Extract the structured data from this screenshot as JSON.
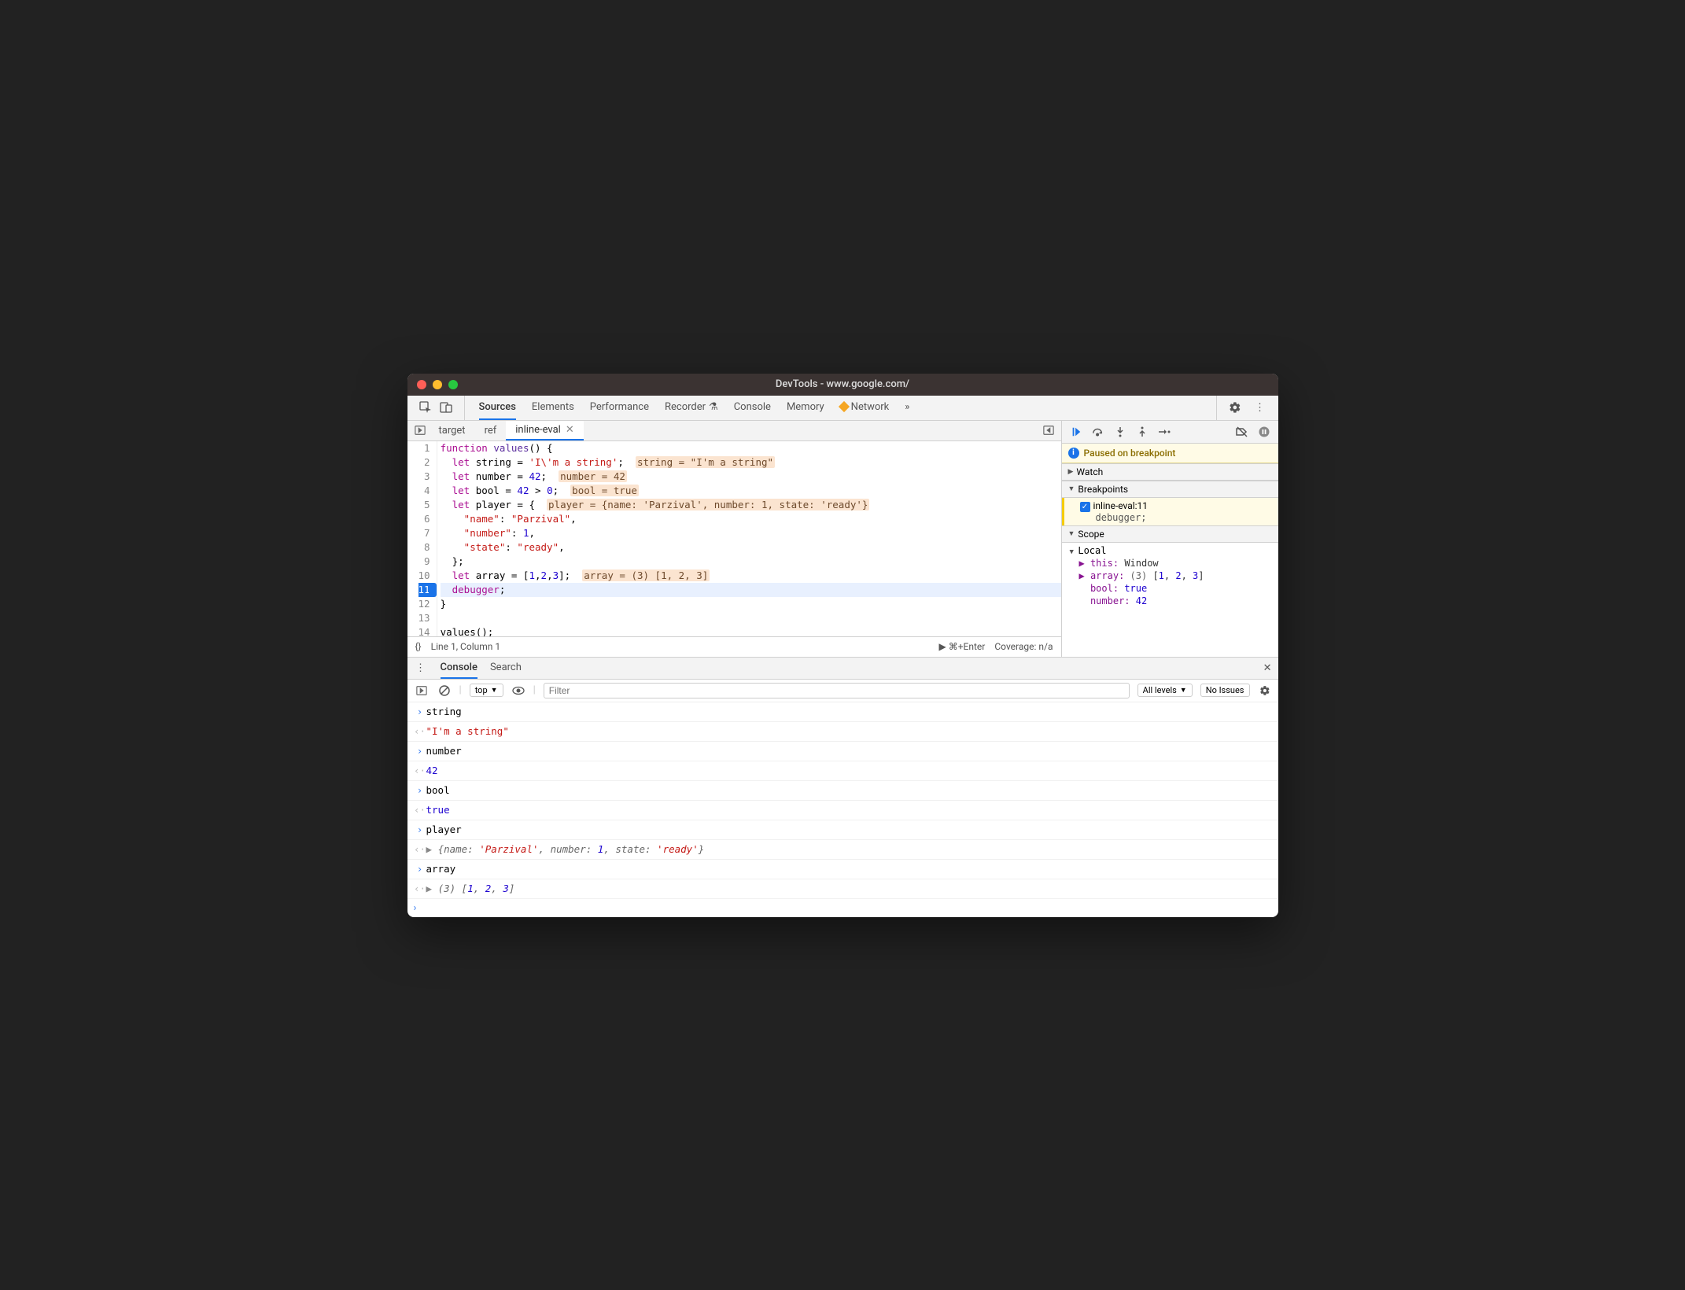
{
  "window": {
    "title": "DevTools - www.google.com/"
  },
  "mainTabs": [
    "Sources",
    "Elements",
    "Performance",
    "Recorder",
    "Console",
    "Memory",
    "Network"
  ],
  "activeMainTab": "Sources",
  "networkWarning": true,
  "fileTabs": {
    "items": [
      "target",
      "ref",
      "inline-eval"
    ],
    "active": "inline-eval"
  },
  "code": {
    "lines": [
      {
        "n": 1,
        "html": "<span class='kw'>function</span> <span class='fn'>values</span>() {"
      },
      {
        "n": 2,
        "html": "  <span class='kw'>let</span> string = <span class='str'>'I\\'m a string'</span>;  <span class='inl'>string = \"I'm a string\"</span>"
      },
      {
        "n": 3,
        "html": "  <span class='kw'>let</span> number = <span class='num'>42</span>;  <span class='inl'>number = 42</span>"
      },
      {
        "n": 4,
        "html": "  <span class='kw'>let</span> bool = <span class='num'>42</span> > <span class='num'>0</span>;  <span class='inl'>bool = true</span>"
      },
      {
        "n": 5,
        "html": "  <span class='kw'>let</span> player = {  <span class='inl'>player = {name: 'Parzival', number: 1, state: 'ready'}</span>"
      },
      {
        "n": 6,
        "html": "    <span class='prop'>\"name\"</span>: <span class='str'>\"Parzival\"</span>,"
      },
      {
        "n": 7,
        "html": "    <span class='prop'>\"number\"</span>: <span class='num'>1</span>,"
      },
      {
        "n": 8,
        "html": "    <span class='prop'>\"state\"</span>: <span class='str'>\"ready\"</span>,"
      },
      {
        "n": 9,
        "html": "  };"
      },
      {
        "n": 10,
        "html": "  <span class='kw'>let</span> array = [<span class='num'>1</span>,<span class='num'>2</span>,<span class='num'>3</span>];  <span class='inl'>array = (3) [1, 2, 3]</span>"
      },
      {
        "n": 11,
        "html": "  <span class='dbg'>debugger</span>;",
        "current": true,
        "bp": true
      },
      {
        "n": 12,
        "html": "}"
      },
      {
        "n": 13,
        "html": ""
      },
      {
        "n": 14,
        "html": "values();"
      }
    ]
  },
  "statusBar": {
    "pretty": "{}",
    "pos": "Line 1, Column 1",
    "run": "▶ ⌘+Enter",
    "coverage": "Coverage: n/a"
  },
  "debugger": {
    "pausedMsg": "Paused on breakpoint",
    "sections": {
      "watch": "Watch",
      "breakpoints": "Breakpoints",
      "scope": "Scope"
    },
    "breakpoint": {
      "label": "inline-eval:11",
      "snippet": "debugger;"
    },
    "scopeLocal": "Local",
    "scope": [
      {
        "k": "▶ this:",
        "v": "Window",
        "vc": "v-dark"
      },
      {
        "k": "▶ array:",
        "v": "(3) [1, 2, 3]",
        "vc": "v-gray",
        "brackets": true
      },
      {
        "k": "  bool:",
        "v": "true",
        "vc": "v-blue"
      },
      {
        "k": "  number:",
        "v": "42",
        "vc": "v-blue"
      }
    ]
  },
  "drawer": {
    "tabs": [
      "Console",
      "Search"
    ],
    "active": "Console",
    "toolbar": {
      "context": "top",
      "filter": "Filter",
      "levels": "All levels",
      "issues": "No Issues"
    },
    "entries": [
      {
        "t": "in",
        "text": "string"
      },
      {
        "t": "out",
        "html": "<span class='str-red'>\"I'm a string\"</span>"
      },
      {
        "t": "in",
        "text": "number"
      },
      {
        "t": "out",
        "html": "<span class='num-blue'>42</span>"
      },
      {
        "t": "in",
        "text": "bool"
      },
      {
        "t": "out",
        "html": "<span class='bool-blue'>true</span>"
      },
      {
        "t": "in",
        "text": "player"
      },
      {
        "t": "out",
        "html": "<span class='obj-tri'>▶ </span><span class='ital'>{name: <span class='str-red'>'Parzival'</span>, number: <span class='num-blue'>1</span>, state: <span class='str-red'>'ready'</span>}</span>"
      },
      {
        "t": "in",
        "text": "array"
      },
      {
        "t": "out",
        "html": "<span class='obj-tri'>▶ </span><span class='ital'>(3) [<span class='num-blue'>1</span>, <span class='num-blue'>2</span>, <span class='num-blue'>3</span>]</span>"
      }
    ]
  }
}
